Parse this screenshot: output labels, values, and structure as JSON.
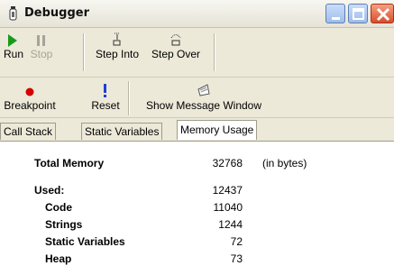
{
  "window": {
    "title": "Debugger"
  },
  "toolbar1": [
    {
      "label": "Run",
      "icon": "run-icon",
      "enabled": true
    },
    {
      "label": "Stop",
      "icon": "stop-icon",
      "enabled": false
    },
    {
      "label": "Step Into",
      "icon": "step-into-icon",
      "enabled": true
    },
    {
      "label": "Step Over",
      "icon": "step-over-icon",
      "enabled": true
    }
  ],
  "toolbar2": [
    {
      "label": "Breakpoint",
      "icon": "breakpoint-icon"
    },
    {
      "label": "Reset",
      "icon": "reset-icon"
    },
    {
      "label": "Show Message Window",
      "icon": "message-window-icon"
    }
  ],
  "tabs": [
    "Call Stack",
    "Static Variables",
    "Memory Usage"
  ],
  "active_tab": "Memory Usage",
  "memory": {
    "total": {
      "label": "Total Memory",
      "value": "32768",
      "unit": "(in bytes)"
    },
    "used": {
      "label": "Used:",
      "value": "12437"
    },
    "items": [
      {
        "label": "Code",
        "value": "11040"
      },
      {
        "label": "Strings",
        "value": "1244"
      },
      {
        "label": "Static Variables",
        "value": "72"
      },
      {
        "label": "Heap",
        "value": "73"
      }
    ]
  },
  "colors": {
    "run": "#1a9a1a",
    "breakpoint": "#d40000",
    "reset": "#1f3fd6",
    "close": "#d74d2c"
  }
}
